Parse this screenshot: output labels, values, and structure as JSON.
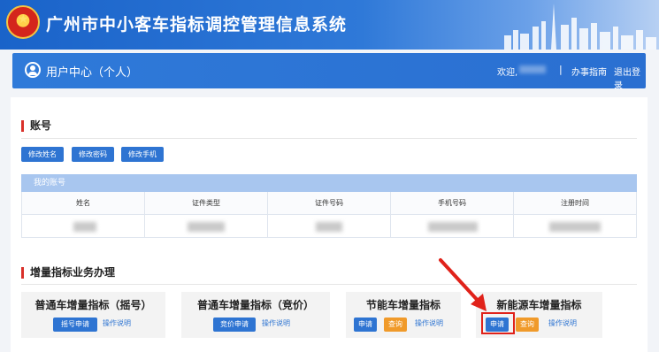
{
  "header": {
    "title": "广州市中小客车指标调控管理信息系统",
    "user_center": "用户中心（个人）",
    "welcome": "欢迎,",
    "separator": "|",
    "guide": "办事指南",
    "logout": "退出登录"
  },
  "account": {
    "title": "账号",
    "buttons": [
      "修改姓名",
      "修改密码",
      "修改手机"
    ],
    "table_caption": "我的账号",
    "columns": [
      "姓名",
      "证件类型",
      "证件号码",
      "手机号码",
      "注册时间"
    ]
  },
  "business": {
    "title": "增量指标业务办理",
    "cards": [
      {
        "title": "普通车增量指标（摇号）",
        "buttons": [
          "摇号申请"
        ],
        "link": "操作说明"
      },
      {
        "title": "普通车增量指标（竞价）",
        "buttons": [
          "竞价申请"
        ],
        "link": "操作说明"
      },
      {
        "title": "节能车增量指标",
        "buttons": [
          "申请",
          "查询"
        ],
        "link": "操作说明"
      },
      {
        "title": "新能源车增量指标",
        "buttons": [
          "申请",
          "查询"
        ],
        "link": "操作说明"
      }
    ]
  },
  "colors": {
    "primary": "#2e74d2",
    "accent_red": "#e0221a",
    "query_orange": "#f09a2a"
  }
}
